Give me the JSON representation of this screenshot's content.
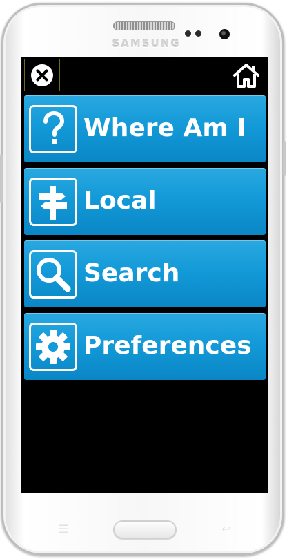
{
  "device": {
    "brand": "SAMSUNG"
  },
  "toolbar": {
    "close_icon": "close-circle-icon",
    "home_icon": "home-icon"
  },
  "menu": {
    "items": [
      {
        "label": "Where Am I",
        "icon": "question-mark-icon"
      },
      {
        "label": "Local",
        "icon": "signpost-icon"
      },
      {
        "label": "Search",
        "icon": "magnifier-icon"
      },
      {
        "label": "Preferences",
        "icon": "gear-icon"
      }
    ]
  },
  "colors": {
    "menu_button": "#139ad8",
    "screen_background": "#000000",
    "text": "#ffffff"
  }
}
